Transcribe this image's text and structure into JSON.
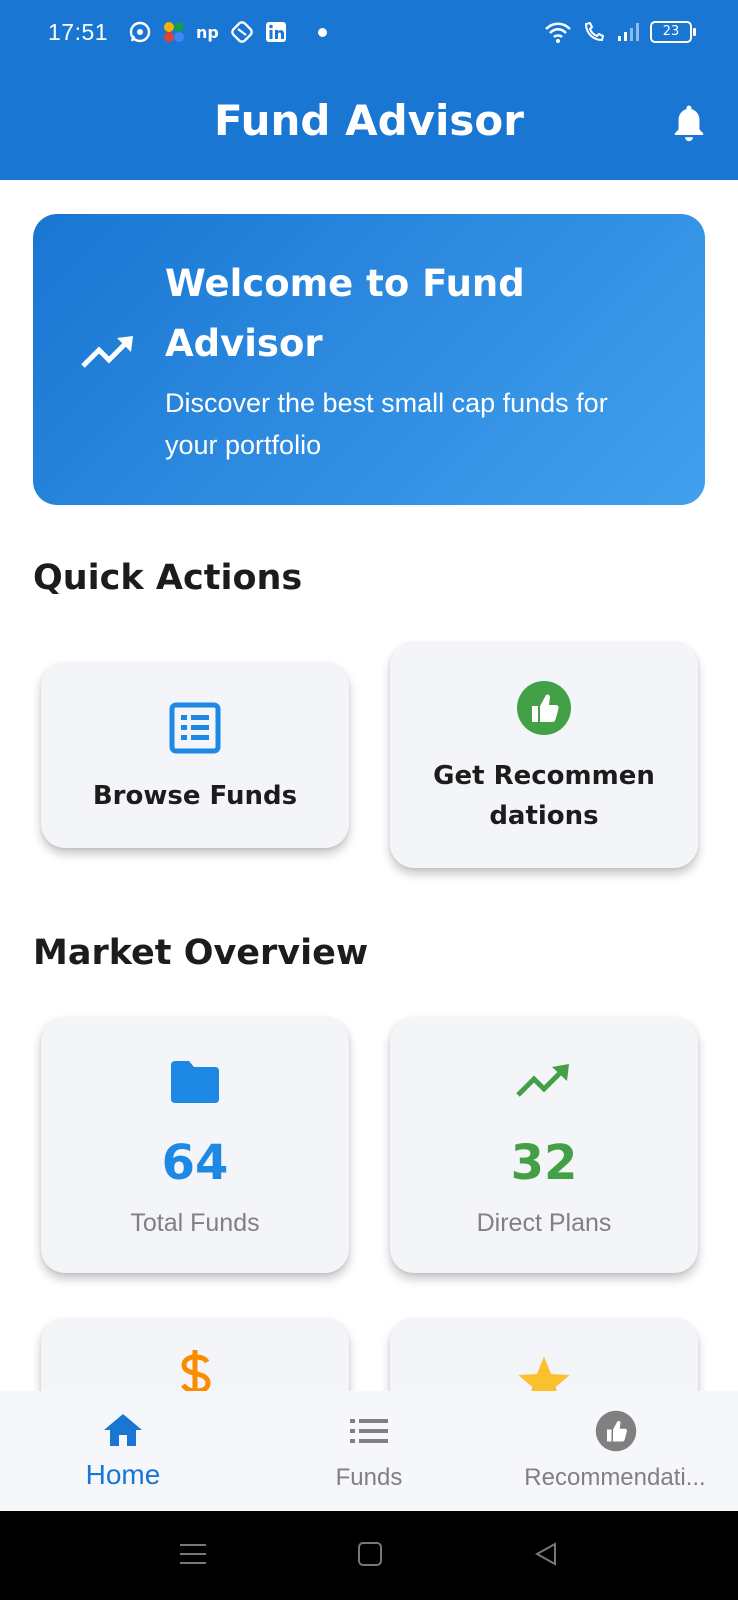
{
  "status_bar": {
    "time": "17:51",
    "battery": "23"
  },
  "app_bar": {
    "title": "Fund Advisor",
    "notification_icon": "bell-icon"
  },
  "welcome_card": {
    "icon": "trending-up-icon",
    "title": "Welcome to Fund Advisor",
    "subtitle": "Discover the best small cap funds for your portfolio"
  },
  "quick_actions": {
    "title": "Quick Actions",
    "items": [
      {
        "label": "Browse Funds",
        "icon": "list-icon",
        "color": "#1E88E5"
      },
      {
        "label": "Get Recommendations",
        "label_line1": "Get Recommen",
        "label_line2": "dations",
        "icon": "thumbs-up-icon",
        "color": "#43A047"
      }
    ]
  },
  "market_overview": {
    "title": "Market Overview",
    "stats": [
      {
        "value": "64",
        "label": "Total Funds",
        "icon": "folder-icon",
        "color": "#1E88E5"
      },
      {
        "value": "32",
        "label": "Direct Plans",
        "icon": "trending-up-icon",
        "color": "#43A047"
      },
      {
        "icon": "dollar-icon",
        "color": "#FB8C00"
      },
      {
        "icon": "star-icon",
        "color": "#FBC02D"
      }
    ]
  },
  "bottom_nav": {
    "items": [
      {
        "label": "Home",
        "icon": "home-icon",
        "active": true
      },
      {
        "label": "Funds",
        "icon": "list-icon",
        "active": false
      },
      {
        "label": "Recommendati...",
        "icon": "thumbs-up-icon",
        "active": false
      }
    ],
    "active_color": "#1976D2",
    "inactive_color": "#808080"
  }
}
